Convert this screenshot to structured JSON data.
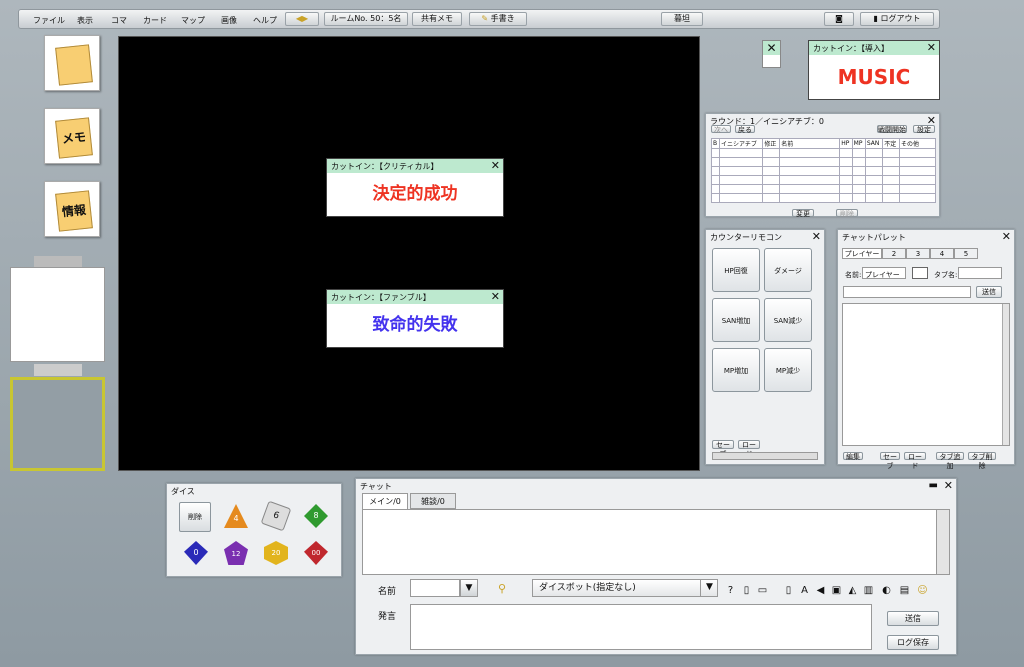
{
  "menu": {
    "items": [
      "ファイル",
      "表示",
      "コマ",
      "カード",
      "マップ",
      "画像",
      "ヘルプ"
    ],
    "room": "ルームNo. 50：5名",
    "shared_memo": "共有メモ",
    "handwrite": "手書き",
    "curtain": "暮坦",
    "logout": "ログアウト"
  },
  "left": {
    "memo": "メモ",
    "info": "情報"
  },
  "cutins": {
    "critical": {
      "title": "カットイン：【クリティカル】",
      "text": "決定的成功",
      "color": "#ee3322"
    },
    "fumble": {
      "title": "カットイン：【ファンブル】",
      "text": "致命的失敗",
      "color": "#4433ee"
    },
    "intro": {
      "title": "カットイン：【導入】",
      "text": "MUSIC",
      "color": "#ee3322"
    }
  },
  "initiative": {
    "title": "ラウンド：1／イニシアチブ：0",
    "btn_next": "次へ",
    "btn_back": "戻る",
    "btn_battle": "戦闘開始",
    "btn_settings": "設定",
    "headers": [
      "B",
      "イニシアチブ",
      "修正",
      "名前",
      "HP",
      "MP",
      "SAN",
      "不定",
      "その他"
    ],
    "btn_change": "変更",
    "btn_delete": "削除"
  },
  "counter": {
    "title": "カウンターリモコン",
    "buttons": [
      "HP回復",
      "ダメージ",
      "SAN増加",
      "SAN減少",
      "MP増加",
      "MP減少"
    ],
    "save": "セーブ",
    "load": "ロード"
  },
  "palette": {
    "title": "チャットパレット",
    "tabs": [
      "プレイヤー",
      "2",
      "3",
      "4",
      "5"
    ],
    "name_label": "名前:",
    "name_value": "プレイヤー",
    "tab_label": "タブ名:",
    "send": "送信",
    "edit": "編集",
    "save": "セーブ",
    "load": "ロード",
    "tab_add": "タブ追加",
    "tab_del": "タブ削除"
  },
  "dice": {
    "title": "ダイス",
    "delete": "削除",
    "labels": [
      "4",
      "6",
      "8",
      "0",
      "12",
      "20",
      "00"
    ]
  },
  "chat": {
    "title": "チャット",
    "tabs": [
      "メイン/0",
      "雑談/0"
    ],
    "name_label": "名前",
    "dicebot": "ダイスボット(指定なし)",
    "say_label": "発言",
    "send": "送信",
    "log_save": "ログ保存"
  }
}
